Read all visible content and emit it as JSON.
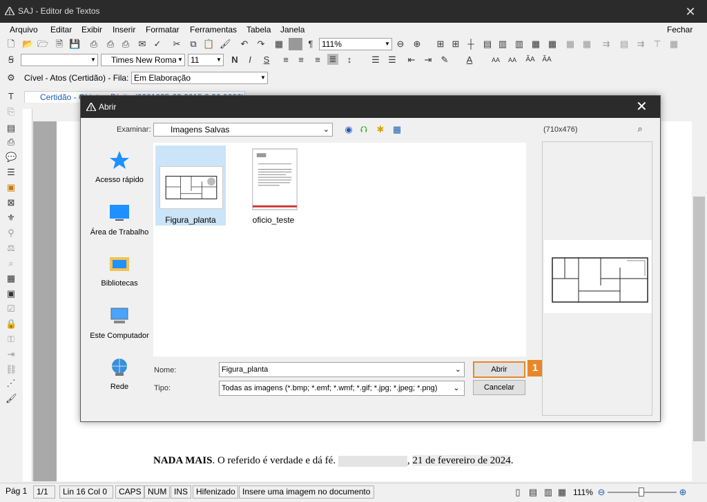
{
  "app": {
    "title": "SAJ - Editor de Textos"
  },
  "menu": [
    "Arquivo",
    "Editar",
    "Exibir",
    "Inserir",
    "Formatar",
    "Ferramentas",
    "Tabela",
    "Janela"
  ],
  "menu_close": "Fechar",
  "toolbar": {
    "zoom": "111%",
    "font": "Times New Roman",
    "font_size": "11"
  },
  "row3": {
    "label": "Cível - Atos (Certidão) - Fila:",
    "queue": "Em Elaboração"
  },
  "doc_tab": "Certidão - Objeto - Dígito (0001035-63.2015.8.26.0666)",
  "doc_text": {
    "bold": "NADA MAIS",
    "rest": ". O referido é verdade e dá fé.",
    "date": "21 de fevereiro de 2024",
    "end": "."
  },
  "dialog": {
    "title": "Abrir",
    "look_in_label": "Examinar:",
    "look_in": "Imagens Salvas",
    "preview_size": "(710x476)",
    "places": [
      "Acesso rápido",
      "Área de Trabalho",
      "Bibliotecas",
      "Este Computador",
      "Rede"
    ],
    "files": [
      "Figura_planta",
      "oficio_teste"
    ],
    "name_label": "Nome:",
    "name_value": "Figura_planta",
    "type_label": "Tipo:",
    "type_value": "Todas as imagens (*.bmp; *.emf; *.wmf; *.gif; *.jpg; *.jpeg; *.png)",
    "open_button": "Abrir",
    "cancel_button": "Cancelar",
    "badge": "1"
  },
  "status": {
    "page": "Pág 1",
    "pages": "1/1",
    "position": "Lin 16  Col 0",
    "caps": "CAPS",
    "num": "NUM",
    "ins": "INS",
    "hyphen": "Hifenizado",
    "hint": "Insere uma imagem no documento",
    "zoom": "111%"
  },
  "colors": {
    "accent": "#e8862a",
    "titlebar": "#2b2b2b",
    "selection": "#cce4f7"
  }
}
